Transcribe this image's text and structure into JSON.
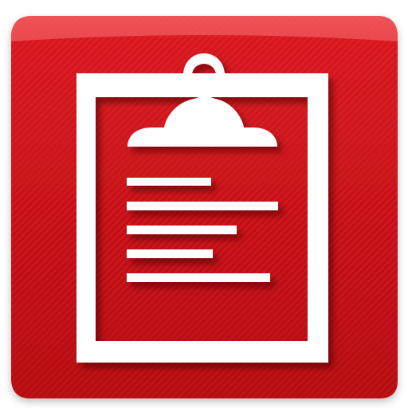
{
  "icon": {
    "name": "clipboard-notes-app-icon",
    "accent_color": "#cc0f16",
    "accent_dark": "#a4070c",
    "accent_light": "#f24a4f",
    "foreground_color": "#ffffff",
    "glyph": "clipboard-icon"
  }
}
